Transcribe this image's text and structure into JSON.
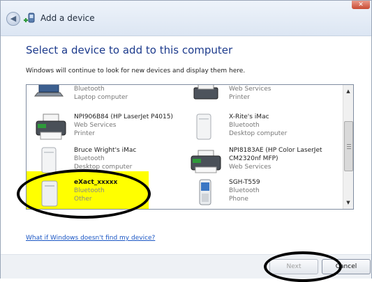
{
  "window": {
    "title": "Add a device"
  },
  "main": {
    "heading": "Select a device to add to this computer",
    "subtext": "Windows will continue to look for new devices and display them here.",
    "help_link": "What if Windows doesn't find my device?"
  },
  "devices": [
    {
      "name": "",
      "line2": "Bluetooth",
      "line3": "Laptop computer",
      "icon": "laptop-icon"
    },
    {
      "name": "",
      "line2": "Web Services",
      "line3": "Printer",
      "icon": "printer-icon"
    },
    {
      "name": "NPI906B84 (HP LaserJet P4015)",
      "line2": "Web Services",
      "line3": "Printer",
      "icon": "printer-icon"
    },
    {
      "name": "X-Rite's iMac",
      "line2": "Bluetooth",
      "line3": "Desktop computer",
      "icon": "desktop-computer-icon"
    },
    {
      "name": "Bruce Wright's iMac",
      "line2": "Bluetooth",
      "line3": "Desktop computer",
      "icon": "desktop-computer-icon"
    },
    {
      "name": "NPI8183AE (HP Color LaserJet",
      "line2": "CM2320nf MFP)",
      "line3": "Web Services",
      "icon": "printer-icon"
    },
    {
      "name": "eXact_xxxxx",
      "line2": "Bluetooth",
      "line3": "Other",
      "icon": "exact-device-icon",
      "selected": true
    },
    {
      "name": "SGH-T559",
      "line2": "Bluetooth",
      "line3": "Phone",
      "icon": "phone-icon"
    }
  ],
  "buttons": {
    "next": "Next",
    "cancel": "Cancel"
  },
  "colors": {
    "highlight": "#ffff00",
    "heading": "#1c3a8c",
    "link": "#1a56c4"
  }
}
